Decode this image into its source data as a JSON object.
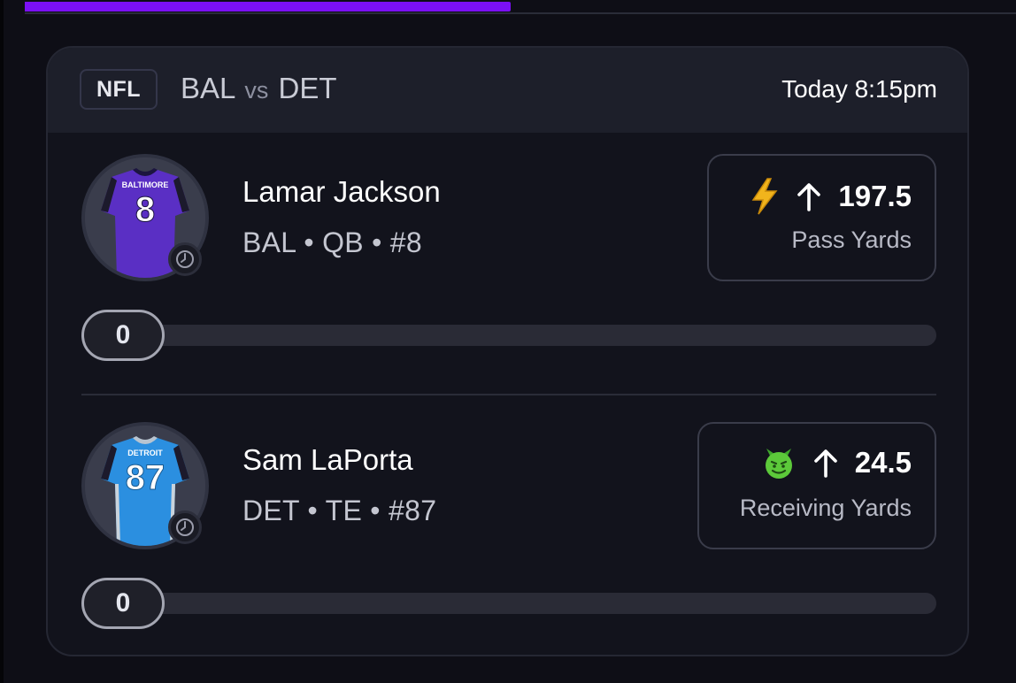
{
  "top_progress": {
    "value_fraction": 0.49,
    "color": "#7b10f5"
  },
  "header": {
    "league": "NFL",
    "home_team": "BAL",
    "vs": "vs",
    "away_team": "DET",
    "time": "Today 8:15pm"
  },
  "players": [
    {
      "name": "Lamar Jackson",
      "meta": "BAL • QB • #8",
      "jersey_text": "BALTIMORE",
      "jersey_number": "8",
      "jersey_color": "#5a2fc4",
      "prop_icon": "lightning-bolt-icon",
      "direction_icon": "arrow-up-icon",
      "line": "197.5",
      "stat": "Pass Yards",
      "live_value": "0"
    },
    {
      "name": "Sam LaPorta",
      "meta": "DET • TE • #87",
      "jersey_text": "DETROIT",
      "jersey_number": "87",
      "jersey_color": "#2b8fe0",
      "prop_icon": "devil-face-icon",
      "direction_icon": "arrow-up-icon",
      "line": "24.5",
      "stat": "Receiving Yards",
      "live_value": "0"
    }
  ]
}
